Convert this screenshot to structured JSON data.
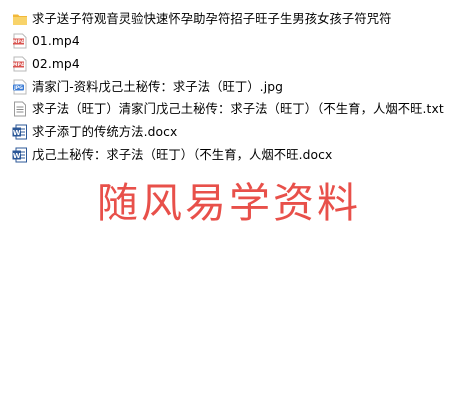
{
  "files": [
    {
      "name": "求子送子符观音灵验快速怀孕助孕符招子旺子生男孩女孩子符咒符",
      "icon": "folder-icon"
    },
    {
      "name": "01.mp4",
      "icon": "video-file-icon"
    },
    {
      "name": "02.mp4",
      "icon": "video-file-icon"
    },
    {
      "name": "清家门-资料戊己土秘传：求子法（旺丁）.jpg",
      "icon": "image-file-icon"
    },
    {
      "name": "求子法（旺丁）清家门戊己土秘传：求子法（旺丁）（不生育，人烟不旺.txt",
      "icon": "text-file-icon"
    },
    {
      "name": "求子添丁的传统方法.docx",
      "icon": "word-document-icon"
    },
    {
      "name": "戊己土秘传：求子法（旺丁）（不生育，人烟不旺.docx",
      "icon": "word-document-icon"
    }
  ],
  "watermark": "随风易学资料",
  "colors": {
    "folder": "#f5c542",
    "video": "#d9534f",
    "image": "#3a7bd5",
    "word": "#2b5797",
    "watermark": "#e8504a"
  }
}
